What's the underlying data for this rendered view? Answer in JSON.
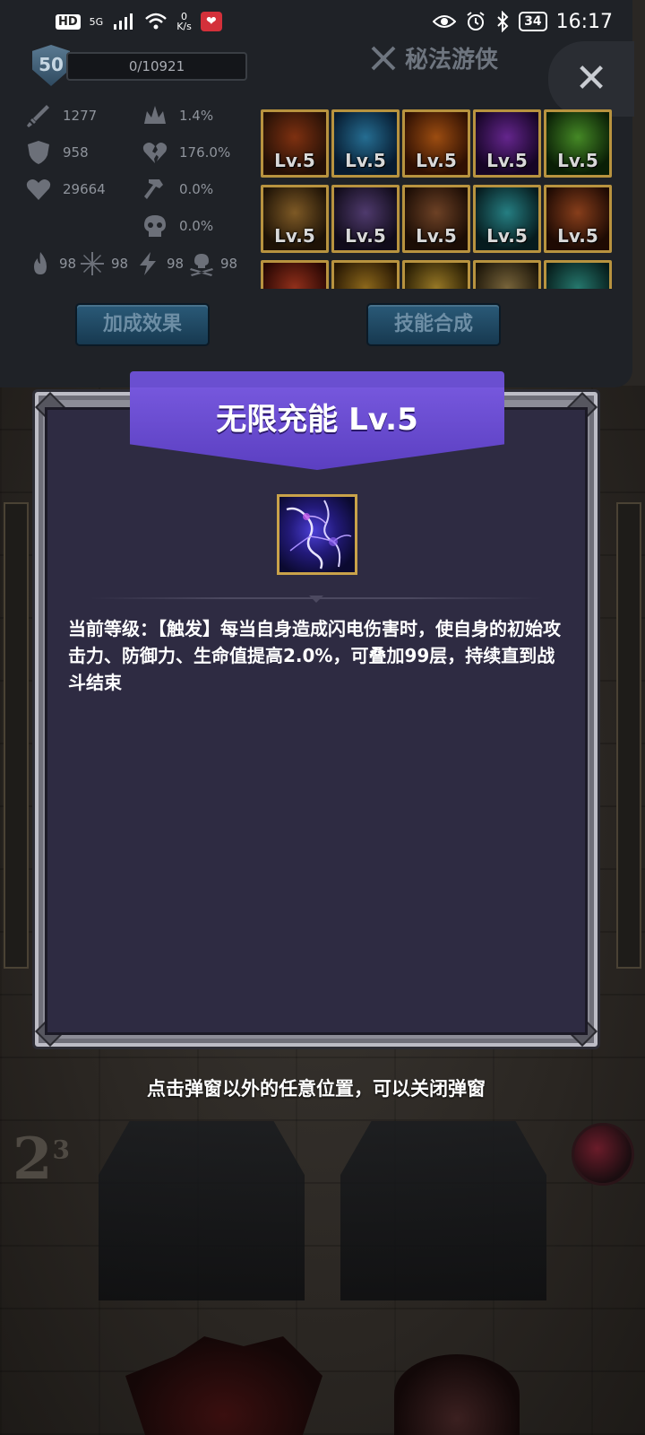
{
  "status_bar": {
    "hd_label": "HD",
    "network_label": "5G",
    "speed_value": "0",
    "speed_unit": "K/s",
    "battery": "34",
    "time": "16:17"
  },
  "hero": {
    "level": "50",
    "xp": "0/10921",
    "class_name": "秘法游侠",
    "close_symbol": "✕"
  },
  "stats": {
    "attack": "1277",
    "defense": "958",
    "hp": "29664",
    "crit_rate": "1.4%",
    "crit_damage": "176.0%",
    "stat_3": "0.0%",
    "stat_4": "0.0%",
    "fire": "98",
    "ice": "98",
    "lightning": "98",
    "poison": "98"
  },
  "skills": [
    {
      "level": "Lv.5",
      "color1": "#c24b1a",
      "color2": "#3a1a0a"
    },
    {
      "level": "Lv.5",
      "color1": "#3aa8e0",
      "color2": "#0b2a4a"
    },
    {
      "level": "Lv.5",
      "color1": "#f0761a",
      "color2": "#4a1a05"
    },
    {
      "level": "Lv.5",
      "color1": "#9a3ad8",
      "color2": "#22083a"
    },
    {
      "level": "Lv.5",
      "color1": "#6ad23a",
      "color2": "#10300a"
    },
    {
      "level": "Lv.5",
      "color1": "#c28a3a",
      "color2": "#2e1d0a"
    },
    {
      "level": "Lv.5",
      "color1": "#7a5aa8",
      "color2": "#1a1228"
    },
    {
      "level": "Lv.5",
      "color1": "#a8653a",
      "color2": "#2a1408"
    },
    {
      "level": "Lv.5",
      "color1": "#3ac2c8",
      "color2": "#0a2a2e"
    },
    {
      "level": "Lv.5",
      "color1": "#d0602a",
      "color2": "#2e1006"
    },
    {
      "level": "",
      "color1": "#e04a2a",
      "color2": "#3a0a05"
    },
    {
      "level": "",
      "color1": "#d8a02a",
      "color2": "#3a2205"
    },
    {
      "level": "",
      "color1": "#e8b83a",
      "color2": "#3a2a05"
    },
    {
      "level": "",
      "color1": "#b89a5a",
      "color2": "#2a200e"
    },
    {
      "level": "",
      "color1": "#3ab8a8",
      "color2": "#0a2a28"
    }
  ],
  "buttons": {
    "bonus": "加成效果",
    "synthesis": "技能合成"
  },
  "popup": {
    "title": "无限充能 Lv.5",
    "description": "当前等级：【触发】每当自身造成闪电伤害时，使自身的初始攻击力、防御力、生命值提高2.0%，可叠加99层，持续直到战斗结束",
    "close_hint": "点击弹窗以外的任意位置，可以关闭弹窗"
  },
  "scene": {
    "wave_number": "2",
    "wave_superscript": "3"
  },
  "colors": {
    "popup_bg": "#2e2b42",
    "banner": "#6a4fd0",
    "frame": "#8d8d97",
    "skill_border": "#b8933f",
    "panel_button": "#2a5a78"
  }
}
